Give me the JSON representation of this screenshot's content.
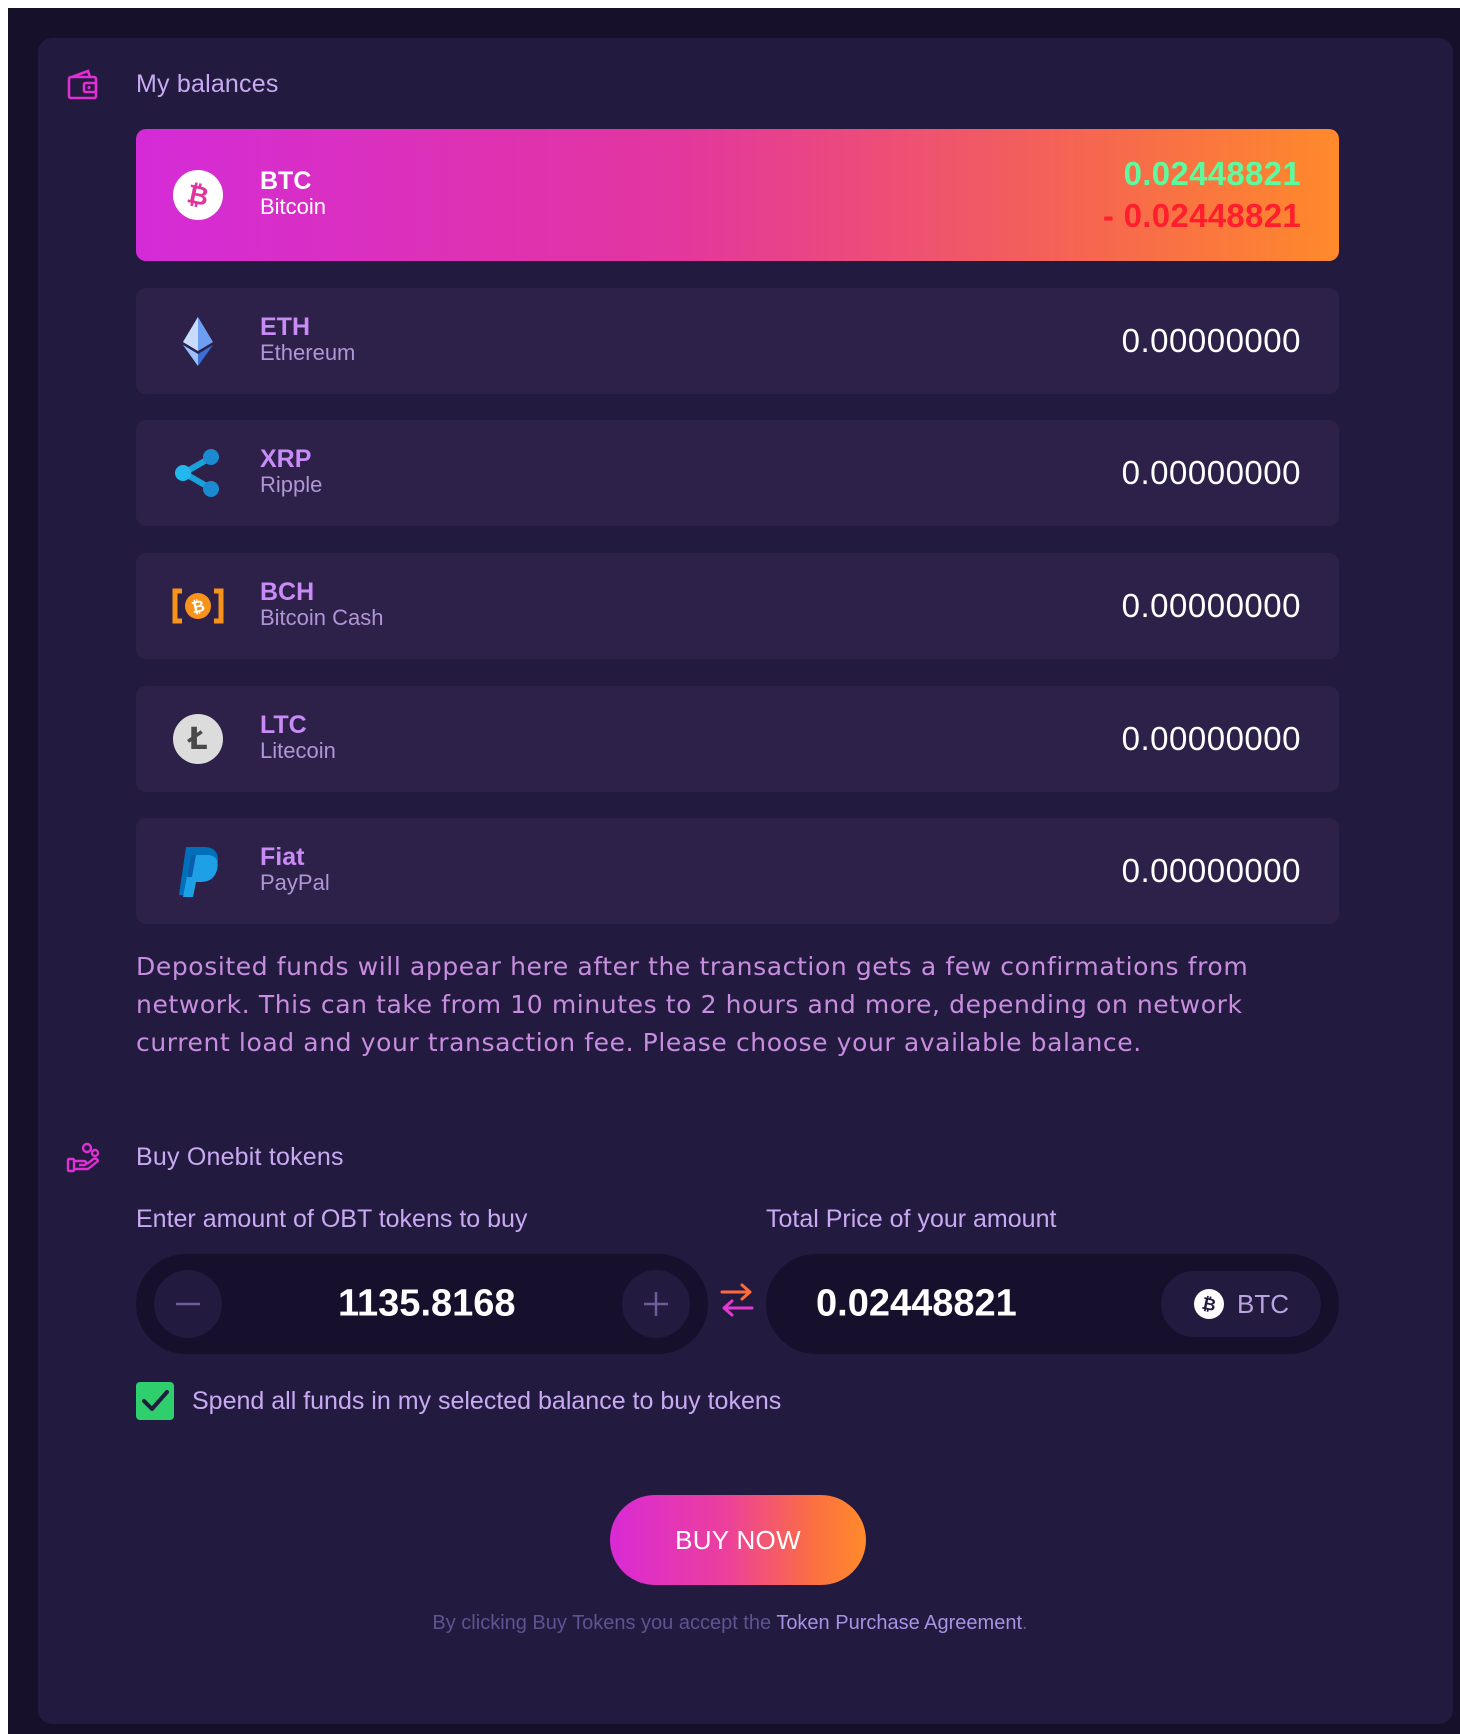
{
  "balances": {
    "title": "My balances",
    "icon": "wallet-icon",
    "items": [
      {
        "symbol": "BTC",
        "name": "Bitcoin",
        "icon": "bitcoin-icon",
        "amount_plus": "0.02448821",
        "amount_minus": "- 0.02448821",
        "selected": true
      },
      {
        "symbol": "ETH",
        "name": "Ethereum",
        "icon": "ethereum-icon",
        "amount": "0.00000000"
      },
      {
        "symbol": "XRP",
        "name": "Ripple",
        "icon": "ripple-icon",
        "amount": "0.00000000"
      },
      {
        "symbol": "BCH",
        "name": "Bitcoin Cash",
        "icon": "bitcoin-cash-icon",
        "amount": "0.00000000"
      },
      {
        "symbol": "LTC",
        "name": "Litecoin",
        "icon": "litecoin-icon",
        "amount": "0.00000000"
      },
      {
        "symbol": "Fiat",
        "name": "PayPal",
        "icon": "paypal-icon",
        "amount": "0.00000000"
      }
    ],
    "note": "Deposited funds will appear here after the transaction gets a few confirmations from network. This can take from 10 minutes to 2 hours and more, depending on network current load and your transaction fee. Please choose your available balance."
  },
  "buy": {
    "title": "Buy Onebit tokens",
    "icon": "hand-coins-icon",
    "amount_label": "Enter amount of OBT tokens to buy",
    "price_label": "Total Price of your amount",
    "amount_value": "1135.8168",
    "price_value": "0.02448821",
    "currency": "BTC",
    "spend_all_label": "Spend all funds in my selected balance to buy tokens",
    "spend_all_checked": true,
    "button_label": "BUY NOW",
    "agreement_prefix": "By clicking Buy Tokens you accept the",
    "agreement_link": "Token Purchase Agreement",
    "agreement_suffix": "."
  },
  "colors": {
    "panel": "#221a3f",
    "row": "#2d2049",
    "accent_pink": "#d42bd8",
    "accent_orange": "#ff8a2a",
    "positive": "#5dfb9d",
    "negative": "#ff1e2d",
    "check": "#2fcf6e"
  }
}
